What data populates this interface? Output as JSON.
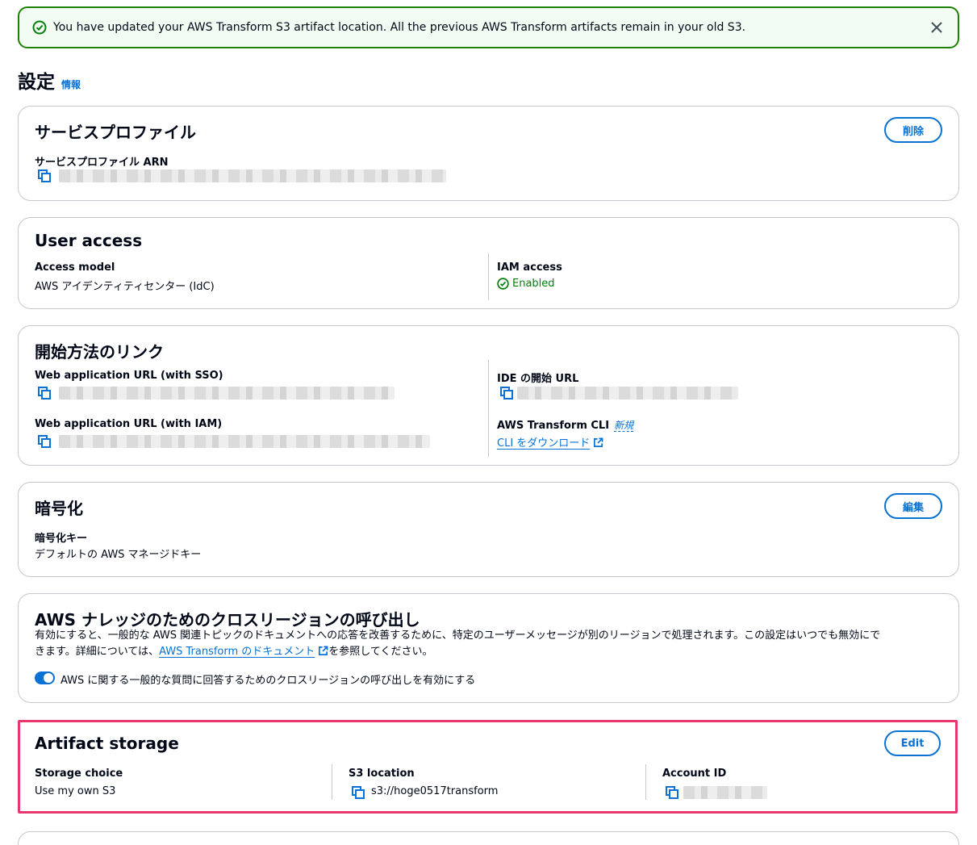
{
  "flash": {
    "message": "You have updated your AWS Transform S3 artifact location. All the previous AWS Transform artifacts remain in your old S3."
  },
  "page": {
    "title": "設定",
    "info": "情報"
  },
  "service_profile": {
    "title": "サービスプロファイル",
    "delete_label": "削除",
    "arn_label": "サービスプロファイル ARN"
  },
  "user_access": {
    "title": "User access",
    "access_model_label": "Access model",
    "access_model_value": "AWS アイデンティティセンター (IdC)",
    "iam_access_label": "IAM access",
    "iam_access_value": "Enabled"
  },
  "getting_started": {
    "title": "開始方法のリンク",
    "web_sso_label": "Web application URL (with SSO)",
    "web_iam_label": "Web application URL (with IAM)",
    "ide_label": "IDE の開始 URL",
    "cli_label": "AWS Transform CLI",
    "cli_new": "新規",
    "cli_download": "CLI をダウンロード"
  },
  "encryption": {
    "title": "暗号化",
    "edit_label": "編集",
    "key_label": "暗号化キー",
    "key_value": "デフォルトの AWS マネージドキー"
  },
  "cross_region": {
    "title": "AWS ナレッジのためのクロスリージョンの呼び出し",
    "desc_line1": "有効にすると、一般的な AWS 関連トピックのドキュメントへの応答を改善するために、特定のユーザーメッセージが別のリージョンで処理されます。この設定はいつでも無効にで",
    "desc_line2_prefix": "きます。詳細については、",
    "desc_link": "AWS Transform のドキュメント",
    "desc_line2_suffix": "を参照してください。",
    "toggle_label": "AWS に関する一般的な質問に回答するためのクロスリージョンの呼び出しを有効にする"
  },
  "artifact_storage": {
    "title": "Artifact storage",
    "edit_label": "Edit",
    "storage_choice_label": "Storage choice",
    "storage_choice_value": "Use my own S3",
    "s3_location_label": "S3 location",
    "s3_location_value": "s3://hoge0517transform",
    "account_id_label": "Account ID"
  },
  "colors": {
    "primary": "#0972d3",
    "success": "#037f0c",
    "highlight": "#e8366f"
  }
}
